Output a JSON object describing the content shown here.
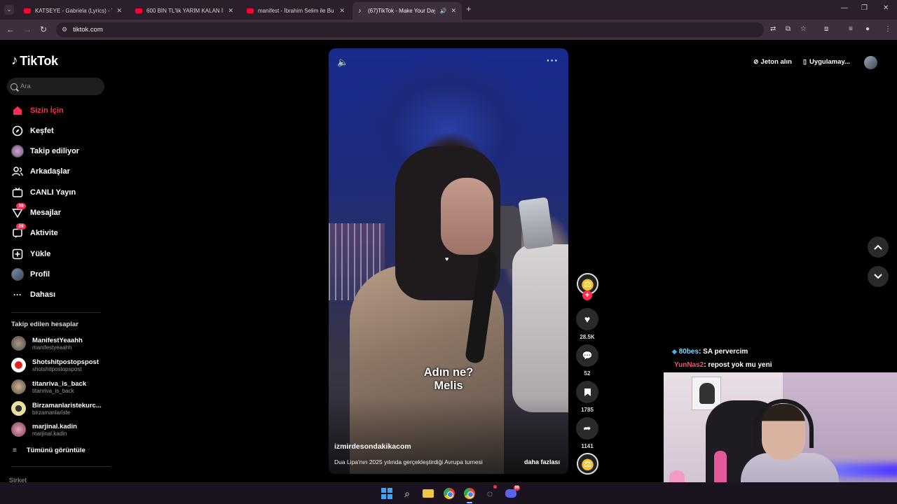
{
  "browser": {
    "tabs": [
      {
        "title": "KATSEYE - Gabriela (Lyrics) - Yo",
        "favicon": "youtube-icon",
        "active": false
      },
      {
        "title": "600 BİN TL'lik YARIM KALAN İŞ",
        "favicon": "youtube-icon",
        "active": false
      },
      {
        "title": "manifest - İbrahim Selim ile Bu",
        "favicon": "youtube-icon",
        "active": false
      },
      {
        "title": "(67)TikTok - Make Your Day",
        "favicon": "tiktok-icon",
        "active": true
      }
    ],
    "url": "tiktok.com"
  },
  "tiktok": {
    "logo_text": "TikTok",
    "search_placeholder": "Ara",
    "nav": [
      {
        "label": "Sizin İçin",
        "icon": "home-icon",
        "active": true
      },
      {
        "label": "Keşfet",
        "icon": "compass-icon"
      },
      {
        "label": "Takip ediliyor",
        "icon": "following-avatar-icon"
      },
      {
        "label": "Arkadaşlar",
        "icon": "friends-icon"
      },
      {
        "label": "CANLI Yayın",
        "icon": "live-tv-icon"
      },
      {
        "label": "Mesajlar",
        "icon": "messages-icon",
        "badge": "39"
      },
      {
        "label": "Aktivite",
        "icon": "activity-icon",
        "badge": "28"
      },
      {
        "label": "Yükle",
        "icon": "upload-icon"
      },
      {
        "label": "Profil",
        "icon": "profile-avatar-icon"
      },
      {
        "label": "Dahası",
        "icon": "more-dots-icon"
      }
    ],
    "followed_title": "Takip edilen hesaplar",
    "followed_accounts": [
      {
        "name": "ManifestYeaahh",
        "handle": "manifestyeaahh"
      },
      {
        "name": "Shotshitpostopspost",
        "handle": "shotshitpostopspost"
      },
      {
        "name": "titanriva_is_back",
        "handle": "titanriva_is_back"
      },
      {
        "name": "Birzamanlaristekurc...",
        "handle": "birzamanlariste"
      },
      {
        "name": "marjinal.kadin",
        "handle": "marjinal.kadin"
      }
    ],
    "see_all": "Tümünü görüntüle",
    "company": "Şirket",
    "topright": {
      "coins": "Jeton alın",
      "app": "Uygulamay..."
    },
    "video": {
      "caption_line1": "Adın ne?",
      "caption_line2": "Melis",
      "author": "izmirdesondakikacom",
      "description": "Dua Lipa'nın 2025 yılında gerçekleştirdiği Avrupa turnesi",
      "more": "daha fazlası"
    },
    "actions": {
      "likes": "28.5K",
      "comments": "52",
      "saves": "1785",
      "shares": "1141"
    }
  },
  "stream_overlay": {
    "chat": [
      {
        "user": "80bes",
        "message": ": SA pervercim"
      },
      {
        "user": "YunNas2",
        "message": ": repost yok mu yeni"
      }
    ]
  },
  "taskbar": {
    "badge": "99"
  },
  "colors": {
    "accent": "#fe2c55",
    "tab_bg": "#2b1f2b",
    "toolbar_bg": "#3d2f3d"
  }
}
